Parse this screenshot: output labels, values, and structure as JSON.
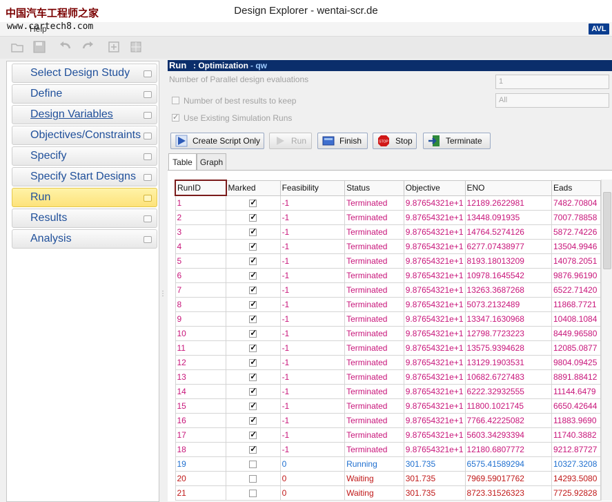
{
  "window": {
    "title": "Design Explorer - wentai-scr.de",
    "watermark_cn": "中国汽车工程师之家",
    "watermark_url": "www.cartech8.com",
    "menu_item": "Help",
    "brand": "AVL"
  },
  "toolbar": {
    "icons": [
      "open-folder-icon",
      "save-icon",
      "undo-icon",
      "redo-icon",
      "export-icon",
      "grid-icon"
    ]
  },
  "sidebar": {
    "items": [
      {
        "label": "Select Design Study"
      },
      {
        "label": "Define"
      },
      {
        "label": "Design Variables"
      },
      {
        "label": "Objectives/Constraints"
      },
      {
        "label": "Specify"
      },
      {
        "label": "Specify Start Designs"
      },
      {
        "label": "Run"
      },
      {
        "label": "Results"
      },
      {
        "label": "Analysis"
      }
    ],
    "active": "Run"
  },
  "main": {
    "header": {
      "section": "Run",
      "sub": ": Optimization",
      "study": "- qw"
    },
    "parallel_label": "Number of Parallel design evaluations",
    "parallel_value": "1",
    "best_label": "Number of best results to keep",
    "best_value": "All",
    "existing_label": "Use Existing Simulation Runs",
    "buttons": {
      "create_script": "Create Script Only",
      "run": "Run",
      "finish": "Finish",
      "stop": "Stop",
      "stop_icon_text": "STOP",
      "terminate": "Terminate"
    },
    "tabs": [
      "Table",
      "Graph"
    ]
  },
  "table": {
    "columns": [
      "RunID",
      "Marked",
      "Feasibility",
      "Status",
      "Objective",
      "ENO",
      "Eads"
    ],
    "rows": [
      {
        "id": "1",
        "marked": true,
        "feas": "-1",
        "status": "Terminated",
        "obj": "9.87654321e+1",
        "eno": "12189.2622981",
        "eads": "7482.70804"
      },
      {
        "id": "2",
        "marked": true,
        "feas": "-1",
        "status": "Terminated",
        "obj": "9.87654321e+1",
        "eno": "13448.091935",
        "eads": "7007.78858"
      },
      {
        "id": "3",
        "marked": true,
        "feas": "-1",
        "status": "Terminated",
        "obj": "9.87654321e+1",
        "eno": "14764.5274126",
        "eads": "5872.74226"
      },
      {
        "id": "4",
        "marked": true,
        "feas": "-1",
        "status": "Terminated",
        "obj": "9.87654321e+1",
        "eno": "6277.07438977",
        "eads": "13504.9946"
      },
      {
        "id": "5",
        "marked": true,
        "feas": "-1",
        "status": "Terminated",
        "obj": "9.87654321e+1",
        "eno": "8193.18013209",
        "eads": "14078.2051"
      },
      {
        "id": "6",
        "marked": true,
        "feas": "-1",
        "status": "Terminated",
        "obj": "9.87654321e+1",
        "eno": "10978.1645542",
        "eads": "9876.96190"
      },
      {
        "id": "7",
        "marked": true,
        "feas": "-1",
        "status": "Terminated",
        "obj": "9.87654321e+1",
        "eno": "13263.3687268",
        "eads": "6522.71420"
      },
      {
        "id": "8",
        "marked": true,
        "feas": "-1",
        "status": "Terminated",
        "obj": "9.87654321e+1",
        "eno": "5073.2132489",
        "eads": "11868.7721"
      },
      {
        "id": "9",
        "marked": true,
        "feas": "-1",
        "status": "Terminated",
        "obj": "9.87654321e+1",
        "eno": "13347.1630968",
        "eads": "10408.1084"
      },
      {
        "id": "10",
        "marked": true,
        "feas": "-1",
        "status": "Terminated",
        "obj": "9.87654321e+1",
        "eno": "12798.7723223",
        "eads": "8449.96580"
      },
      {
        "id": "11",
        "marked": true,
        "feas": "-1",
        "status": "Terminated",
        "obj": "9.87654321e+1",
        "eno": "13575.9394628",
        "eads": "12085.0877"
      },
      {
        "id": "12",
        "marked": true,
        "feas": "-1",
        "status": "Terminated",
        "obj": "9.87654321e+1",
        "eno": "13129.1903531",
        "eads": "9804.09425"
      },
      {
        "id": "13",
        "marked": true,
        "feas": "-1",
        "status": "Terminated",
        "obj": "9.87654321e+1",
        "eno": "10682.6727483",
        "eads": "8891.88412"
      },
      {
        "id": "14",
        "marked": true,
        "feas": "-1",
        "status": "Terminated",
        "obj": "9.87654321e+1",
        "eno": "6222.32932555",
        "eads": "11144.6479"
      },
      {
        "id": "15",
        "marked": true,
        "feas": "-1",
        "status": "Terminated",
        "obj": "9.87654321e+1",
        "eno": "11800.1021745",
        "eads": "6650.42644"
      },
      {
        "id": "16",
        "marked": true,
        "feas": "-1",
        "status": "Terminated",
        "obj": "9.87654321e+1",
        "eno": "7766.42225082",
        "eads": "11883.9690"
      },
      {
        "id": "17",
        "marked": true,
        "feas": "-1",
        "status": "Terminated",
        "obj": "9.87654321e+1",
        "eno": "5603.34293394",
        "eads": "11740.3882"
      },
      {
        "id": "18",
        "marked": true,
        "feas": "-1",
        "status": "Terminated",
        "obj": "9.87654321e+1",
        "eno": "12180.6807772",
        "eads": "9212.87727"
      },
      {
        "id": "19",
        "marked": false,
        "feas": "0",
        "status": "Running",
        "obj": "301.735",
        "eno": "6575.41589294",
        "eads": "10327.3208"
      },
      {
        "id": "20",
        "marked": false,
        "feas": "0",
        "status": "Waiting",
        "obj": "301.735",
        "eno": "7969.59017762",
        "eads": "14293.5080"
      },
      {
        "id": "21",
        "marked": false,
        "feas": "0",
        "status": "Waiting",
        "obj": "301.735",
        "eno": "8723.31526323",
        "eads": "7725.92828"
      }
    ],
    "colors": {
      "Terminated": "#c8157a",
      "Running": "#1f6fcf",
      "Waiting": "#c01818"
    }
  }
}
